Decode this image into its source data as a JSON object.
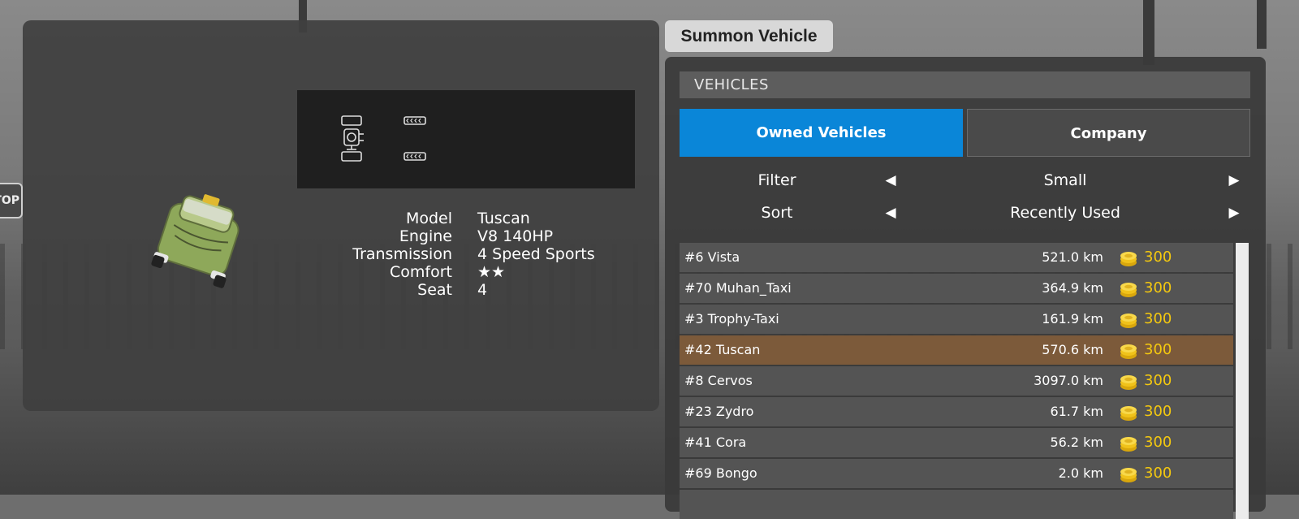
{
  "summon": {
    "title": "Summon Vehicle"
  },
  "vehicles_panel": {
    "section_header": "VEHICLES",
    "tabs": [
      {
        "label": "Owned Vehicles",
        "active": true
      },
      {
        "label": "Company",
        "active": false
      }
    ],
    "filter": {
      "label": "Filter",
      "value": "Small"
    },
    "sort": {
      "label": "Sort",
      "value": "Recently Used"
    },
    "list": [
      {
        "name": "#6 Vista",
        "distance": "521.0 km",
        "cost": "300",
        "selected": false
      },
      {
        "name": "#70 Muhan_Taxi",
        "distance": "364.9 km",
        "cost": "300",
        "selected": false
      },
      {
        "name": "#3 Trophy-Taxi",
        "distance": "161.9 km",
        "cost": "300",
        "selected": false
      },
      {
        "name": "#42 Tuscan",
        "distance": "570.6 km",
        "cost": "300",
        "selected": true
      },
      {
        "name": "#8 Cervos",
        "distance": "3097.0 km",
        "cost": "300",
        "selected": false
      },
      {
        "name": "#23 Zydro",
        "distance": "61.7 km",
        "cost": "300",
        "selected": false
      },
      {
        "name": "#41 Cora",
        "distance": "56.2 km",
        "cost": "300",
        "selected": false
      },
      {
        "name": "#69 Bongo",
        "distance": "2.0 km",
        "cost": "300",
        "selected": false
      }
    ]
  },
  "vehicle_info": {
    "specs": [
      {
        "label": "Model",
        "value": "Tuscan"
      },
      {
        "label": "Engine",
        "value": "V8 140HP"
      },
      {
        "label": "Transmission",
        "value": "4 Speed Sports"
      },
      {
        "label": "Comfort",
        "value": "★★"
      },
      {
        "label": "Seat",
        "value": "4"
      }
    ]
  },
  "colors": {
    "accent_blue": "#0a86d8",
    "selected_row": "#7c5a3a",
    "coin_gold": "#f5c90f"
  },
  "icons": {
    "car": "taxi-car-icon",
    "engine": "engine-icon",
    "wheel": "wheel-icon",
    "tire": "tire-icon",
    "coin": "coin-stack-icon",
    "prev": "arrow-left-icon",
    "next": "arrow-right-icon"
  }
}
